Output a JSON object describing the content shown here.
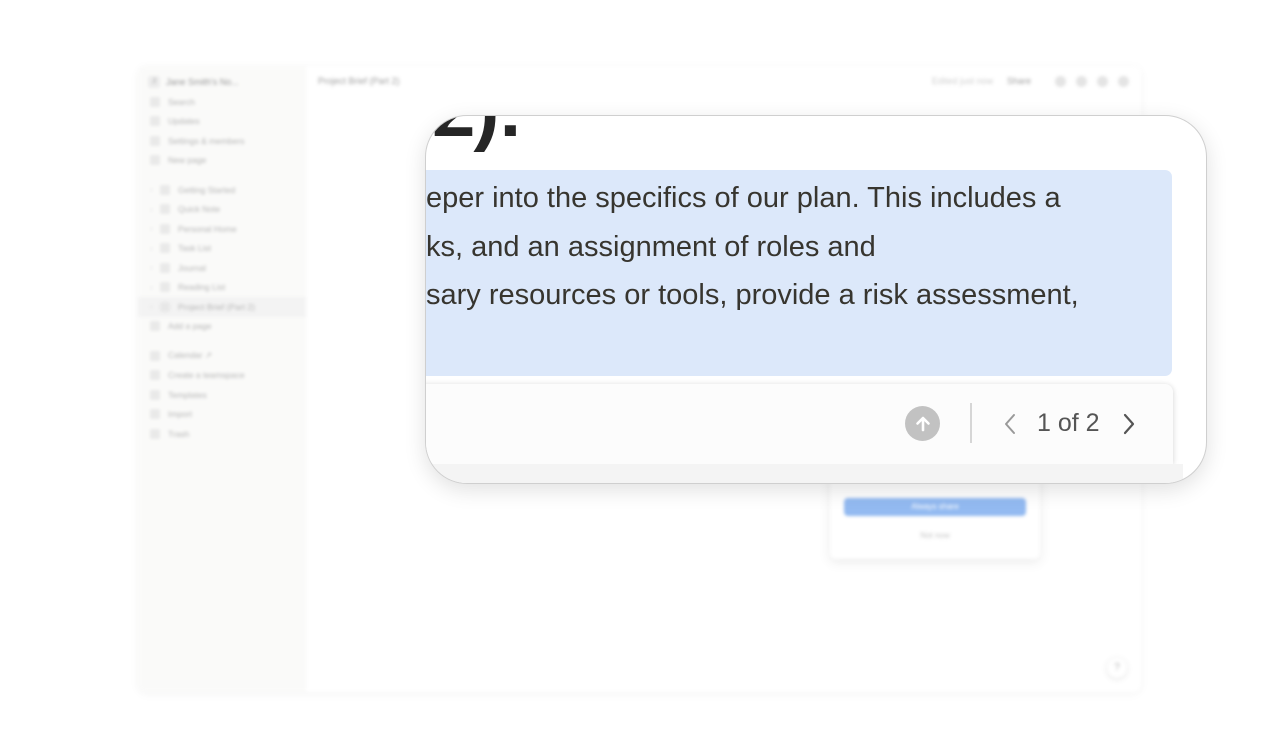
{
  "sidebar": {
    "workspace": "Jane Smith's No...",
    "workspace_initial": "J",
    "nav": [
      {
        "label": "Search",
        "icon": "search-icon"
      },
      {
        "label": "Updates",
        "icon": "clock-icon"
      },
      {
        "label": "Settings & members",
        "icon": "gear-icon"
      },
      {
        "label": "New page",
        "icon": "plus-circle-icon"
      }
    ],
    "pages": [
      {
        "label": "Getting Started",
        "icon": "page-icon"
      },
      {
        "label": "Quick Note",
        "icon": "pin-icon"
      },
      {
        "label": "Personal Home",
        "icon": "person-icon"
      },
      {
        "label": "Task List",
        "icon": "checklist-icon"
      },
      {
        "label": "Journal",
        "icon": "book-icon"
      },
      {
        "label": "Reading List",
        "icon": "list-icon"
      },
      {
        "label": "Project Brief (Part 2)",
        "icon": "page-icon"
      }
    ],
    "add_page": "Add a page",
    "footer": [
      {
        "label": "Calendar ↗",
        "icon": "calendar-icon"
      },
      {
        "label": "Create a teamspace",
        "icon": "teamspace-icon"
      },
      {
        "label": "Templates",
        "icon": "template-icon"
      },
      {
        "label": "Import",
        "icon": "import-icon"
      },
      {
        "label": "Trash",
        "icon": "trash-icon"
      }
    ]
  },
  "topbar": {
    "breadcrumb": "Project Brief (Part 2)",
    "edited": "Edited just now",
    "share": "Share"
  },
  "popup": {
    "primary": "Always share",
    "secondary": "Not now"
  },
  "help": "?",
  "document": {
    "heading_fragment": "2):",
    "lines": [
      "eper into the specifics of our plan. This includes a",
      "ks, and an assignment of roles and",
      "sary resources or tools, provide a risk assessment,"
    ]
  },
  "find": {
    "counter": "1 of 2"
  },
  "colors": {
    "highlight": "#dce8fa",
    "accent": "#3b82e6"
  }
}
